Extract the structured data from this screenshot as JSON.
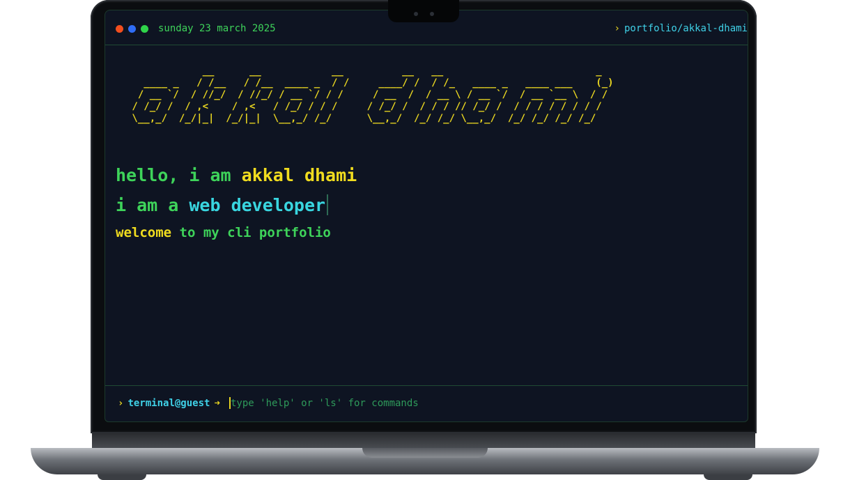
{
  "titlebar": {
    "date": "sunday 23 march 2025",
    "path": "portfolio/akkal-dhami",
    "dots": {
      "red": "#f24e1e",
      "blue": "#2f6df6",
      "green": "#2fd44a"
    }
  },
  "banner": {
    "ascii": "             __      __            __          __   __                          _ \n   ____ _   / /__   / /__  ____ _  / /     ____/ /  / /_   ____ _   ____ ___    (_)\n  / __ `/  / //_/  / //_/ / __ `/ / /     / __  /  / __ \\ / __ `/  / __ `__ \\  / / \n / /_/ /  / ,<    / ,<   / /_/ / / /     / /_/ /  / / / // /_/ /  / / / / / / / /  \n \\__,_/  /_/|_|  /_/|_|  \\__,_/ /_/      \\__,_/  /_/ /_/ \\__,_/  /_/ /_/ /_/ /_/   "
  },
  "intro": {
    "greeting": "hello, i am",
    "name": "akkal dhami",
    "role_prefix": "i am a",
    "role": "web developer",
    "welcome_word": "welcome",
    "welcome_rest": "to my cli portfolio"
  },
  "prompt": {
    "label": "terminal@guest",
    "arrow": "➜",
    "placeholder": "type 'help' or 'ls' for commands"
  },
  "colors": {
    "background": "#0e1422",
    "green": "#3ed35a",
    "yellow": "#f0dc1f",
    "cyan": "#3fd0e6"
  }
}
